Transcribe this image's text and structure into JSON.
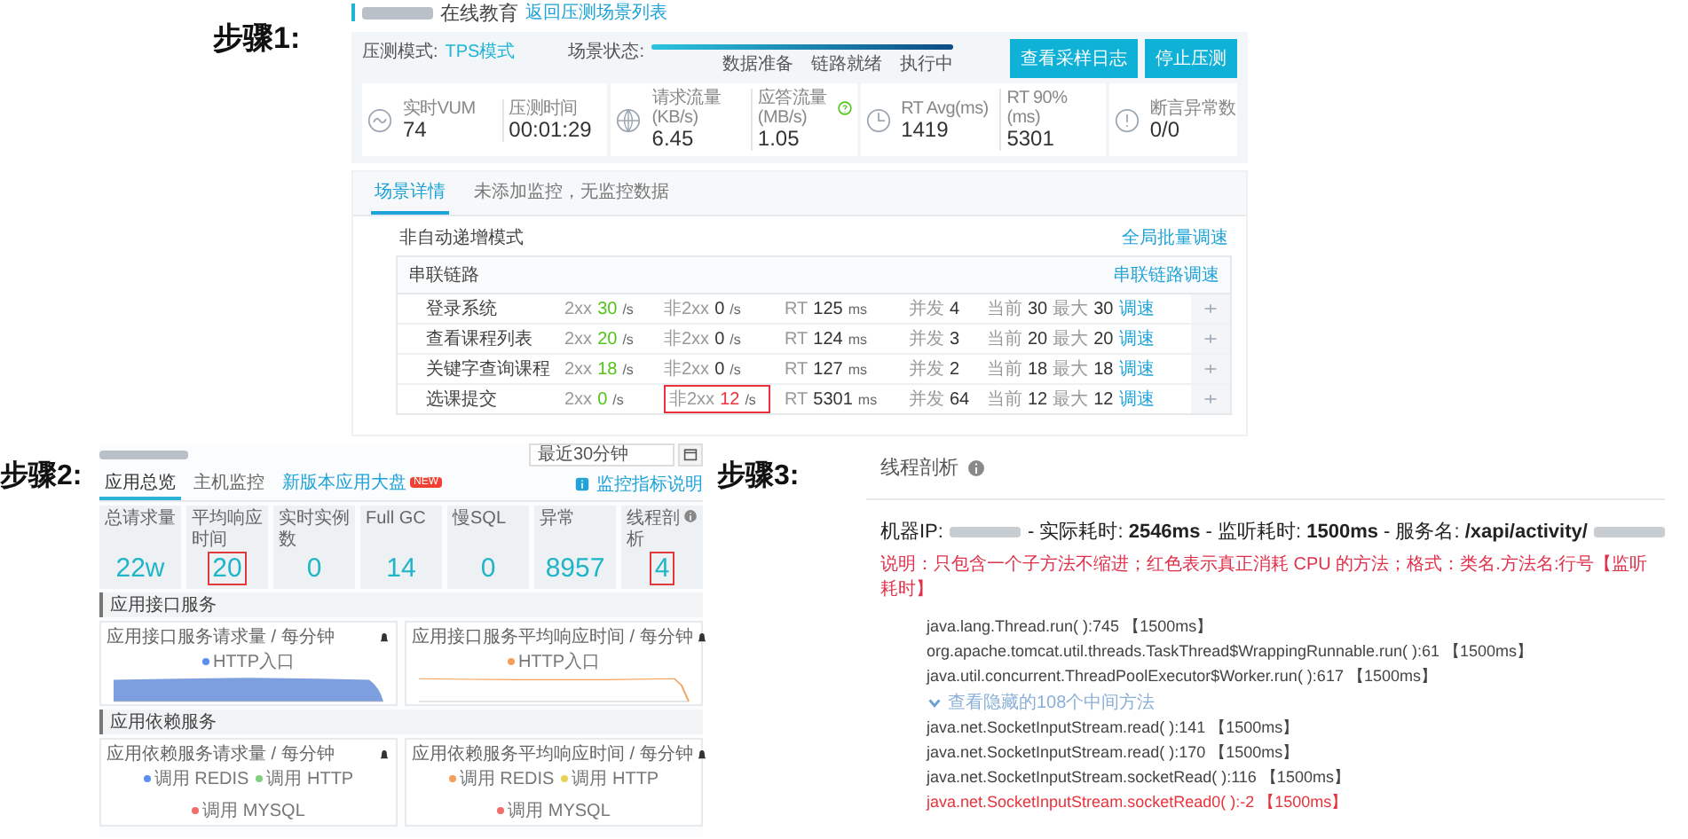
{
  "step1": {
    "label": "步骤1:",
    "header": {
      "title": "在线教育",
      "link": "返回压测场景列表"
    },
    "mode": {
      "label": "压测模式:",
      "value": "TPS模式"
    },
    "status": {
      "label": "场景状态:",
      "level": 1,
      "stages": [
        "数据准备",
        "链路就绪",
        "执行中"
      ]
    },
    "buttons": [
      "查看采样日志",
      "停止压测"
    ],
    "metric_groups": [
      {
        "metrics": [
          {
            "label": "实时VUM",
            "value": "74",
            "help": false
          },
          {
            "label": "压测时间",
            "value": "00:01:29",
            "help": false
          }
        ]
      },
      {
        "metrics": [
          {
            "label": "请求流量 (KB/s)",
            "value": "6.45",
            "help": false
          },
          {
            "label": "应答流量 (MB/s)",
            "value": "1.05",
            "help": true
          }
        ]
      },
      {
        "metrics": [
          {
            "label": "RT Avg(ms)",
            "value": "1419",
            "help": false
          },
          {
            "label": "RT 90%(ms)",
            "value": "5301",
            "help": false
          }
        ]
      },
      {
        "metrics": [
          {
            "label": "断言异常数",
            "value": "0/0",
            "help": false
          }
        ]
      }
    ],
    "tabs": [
      {
        "label": "场景详情",
        "selected": true
      },
      {
        "label": "未添加监控，无监控数据",
        "selected": false
      }
    ],
    "mode_title": "非自动递增模式",
    "global_link": "全局批量调速",
    "chain": {
      "name": "串联链路",
      "link": "串联链路调速"
    },
    "rows": [
      {
        "name": "登录系统",
        "ok_label": "2xx",
        "ok": "30",
        "err_label": "非2xx",
        "err": "0",
        "err_alert": false,
        "rt_label": "RT",
        "rt": "125",
        "conc_label": "并发",
        "conc": "4",
        "cur_label": "当前",
        "cur": "30",
        "max_label": "最大",
        "max": "30",
        "action": "调速",
        "ok_unit": "/s",
        "err_unit": "/s",
        "rt_unit": "ms"
      },
      {
        "name": "查看课程列表",
        "ok_label": "2xx",
        "ok": "20",
        "err_label": "非2xx",
        "err": "0",
        "err_alert": false,
        "rt_label": "RT",
        "rt": "124",
        "conc_label": "并发",
        "conc": "3",
        "cur_label": "当前",
        "cur": "20",
        "max_label": "最大",
        "max": "20",
        "action": "调速",
        "ok_unit": "/s",
        "err_unit": "/s",
        "rt_unit": "ms"
      },
      {
        "name": "关键字查询课程",
        "ok_label": "2xx",
        "ok": "18",
        "err_label": "非2xx",
        "err": "0",
        "err_alert": false,
        "rt_label": "RT",
        "rt": "127",
        "conc_label": "并发",
        "conc": "2",
        "cur_label": "当前",
        "cur": "18",
        "max_label": "最大",
        "max": "18",
        "action": "调速",
        "ok_unit": "/s",
        "err_unit": "/s",
        "rt_unit": "ms"
      },
      {
        "name": "选课提交",
        "ok_label": "2xx",
        "ok": "0",
        "err_label": "非2xx",
        "err": "12",
        "err_alert": true,
        "rt_label": "RT",
        "rt": "5301",
        "conc_label": "并发",
        "conc": "64",
        "cur_label": "当前",
        "cur": "12",
        "max_label": "最大",
        "max": "12",
        "action": "调速",
        "ok_unit": "/s",
        "err_unit": "/s",
        "rt_unit": "ms"
      }
    ]
  },
  "step2": {
    "label": "步骤2:",
    "time_field": "最近30分钟",
    "tabs": [
      {
        "label": "应用总览",
        "selected": true
      },
      {
        "label": "主机监控",
        "selected": false
      },
      {
        "label": "新版本应用大盘",
        "selected": false,
        "badge": "NEW"
      }
    ],
    "help_link": "监控指标说明",
    "cards": [
      {
        "title": "总请求量",
        "value": "22w",
        "highlight": false,
        "help": false
      },
      {
        "title": "平均响应时间",
        "value": "20",
        "highlight": true,
        "help": false
      },
      {
        "title": "实时实例数",
        "value": "0",
        "highlight": false,
        "help": false
      },
      {
        "title": "Full GC",
        "value": "14",
        "highlight": false,
        "help": false
      },
      {
        "title": "慢SQL",
        "value": "0",
        "highlight": false,
        "help": false
      },
      {
        "title": "异常",
        "value": "8957",
        "highlight": false,
        "help": false
      },
      {
        "title": "线程剖析",
        "value": "4",
        "highlight": true,
        "help": true
      }
    ],
    "sections": [
      {
        "title": "应用接口服务",
        "charts": [
          {
            "title": "应用接口服务请求量 / 每分钟",
            "kind": "area",
            "legend": [
              {
                "label": "HTTP入口",
                "color": "#5b8ff0"
              }
            ]
          },
          {
            "title": "应用接口服务平均响应时间 / 每分钟",
            "kind": "line",
            "legend": [
              {
                "label": "HTTP入口",
                "color": "#f5a05a"
              }
            ]
          }
        ]
      },
      {
        "title": "应用依赖服务",
        "charts": [
          {
            "title": "应用依赖服务请求量 / 每分钟",
            "kind": "legend",
            "legend": [
              {
                "label": "调用 REDIS",
                "color": "#5b8ff0"
              },
              {
                "label": "调用 HTTP",
                "color": "#7fd07f"
              },
              {
                "label": "调用 MYSQL",
                "color": "#f36c6c"
              }
            ]
          },
          {
            "title": "应用依赖服务平均响应时间 / 每分钟",
            "kind": "legend",
            "legend": [
              {
                "label": "调用 REDIS",
                "color": "#f5a05a"
              },
              {
                "label": "调用 HTTP",
                "color": "#e6d25a"
              },
              {
                "label": "调用 MYSQL",
                "color": "#f36c6c"
              }
            ]
          }
        ]
      }
    ]
  },
  "step3": {
    "label": "步骤3:",
    "title": "线程剖析",
    "ip_label": "机器IP:",
    "timing": "- 实际耗时: **2546ms** - 监听耗时: **1500ms** - 服务名: **/xapi/activity/**",
    "note": "说明：只包含一个子方法不缩进；红色表示真正消耗 CPU 的方法；格式：类名.方法名:行号【监听耗时】",
    "items": [
      {
        "kind": "frame",
        "text": "java.lang.Thread.run( ):745 【1500ms】",
        "hot": false
      },
      {
        "kind": "frame",
        "text": "org.apache.tomcat.util.threads.TaskThread$WrappingRunnable.run( ):61 【1500ms】",
        "hot": false
      },
      {
        "kind": "frame",
        "text": "java.util.concurrent.ThreadPoolExecutor$Worker.run( ):617 【1500ms】",
        "hot": false
      },
      {
        "kind": "toggle",
        "text": "查看隐藏的108个中间方法"
      },
      {
        "kind": "frame",
        "text": "java.net.SocketInputStream.read( ):141 【1500ms】",
        "hot": false
      },
      {
        "kind": "frame",
        "text": "java.net.SocketInputStream.read( ):170 【1500ms】",
        "hot": false
      },
      {
        "kind": "frame",
        "text": "java.net.SocketInputStream.socketRead( ):116 【1500ms】",
        "hot": false
      },
      {
        "kind": "frame",
        "text": "java.net.SocketInputStream.socketRead0( ):-2 【1500ms】",
        "hot": true
      }
    ]
  }
}
